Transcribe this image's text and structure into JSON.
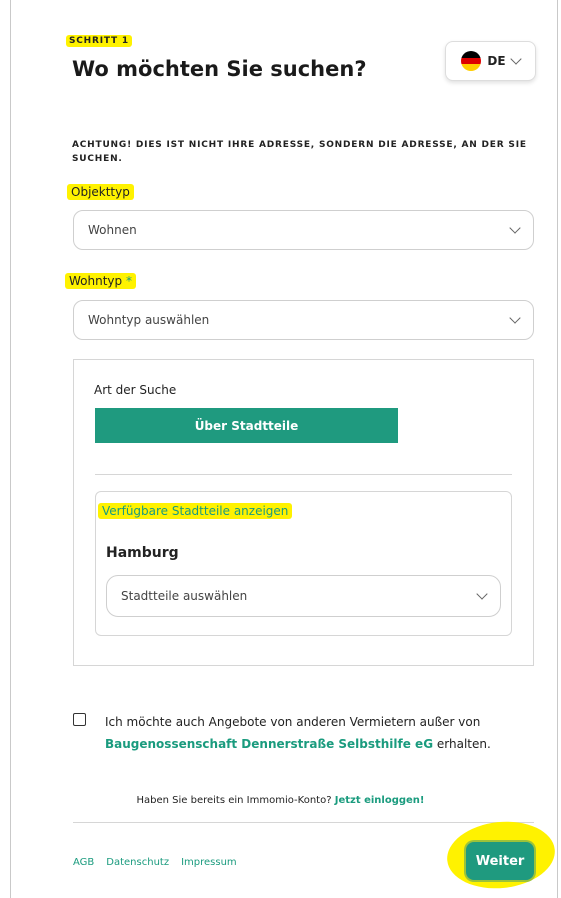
{
  "step_label": "SCHRITT 1",
  "page_title": "Wo möchten Sie suchen?",
  "language": {
    "code": "DE",
    "flag_icon": "german-flag-icon"
  },
  "warning": "ACHTUNG! DIES IST NICHT IHRE ADRESSE, SONDERN DIE ADRESSE, AN DER SIE SUCHEN.",
  "object_type": {
    "label": "Objekttyp",
    "value": "Wohnen"
  },
  "living_type": {
    "label": "Wohntyp",
    "required_mark": "*",
    "placeholder": "Wohntyp auswählen"
  },
  "search_type": {
    "label": "Art der Suche",
    "button_label": "Über Stadtteile",
    "show_districts_link": "Verfügbare Stadtteile anzeigen",
    "city": "Hamburg",
    "districts_placeholder": "Stadtteile auswählen"
  },
  "consent": {
    "text_before": "Ich möchte auch Angebote von anderen Vermietern außer von",
    "company": "Baugenossenschaft Dennerstraße Selbsthilfe eG",
    "text_after": "erhalten."
  },
  "login_prompt": {
    "text": "Haben Sie bereits ein Immomio-Konto?",
    "link": "Jetzt einloggen!"
  },
  "footer": {
    "links": [
      "AGB",
      "Datenschutz",
      "Impressum"
    ],
    "next_button": "Weiter"
  },
  "colors": {
    "accent": "#1f9a7f",
    "highlight": "#fff200"
  }
}
